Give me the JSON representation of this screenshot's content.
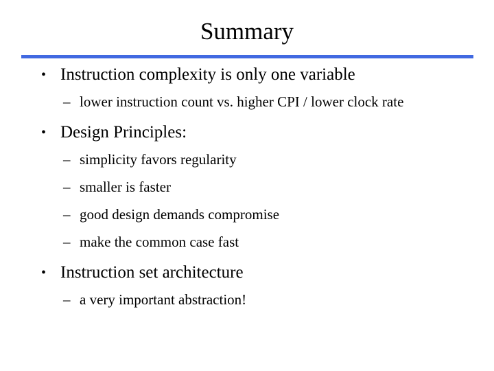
{
  "slide": {
    "title": "Summary",
    "accent_color": "#4169e1",
    "background_color": "#ffffff",
    "text_color": "#000000",
    "level1_marker": "•",
    "level2_marker": "–",
    "bullets": [
      {
        "text": "Instruction complexity is only one variable",
        "sub": [
          "lower instruction count vs. higher CPI / lower clock rate"
        ]
      },
      {
        "text": "Design Principles:",
        "sub": [
          "simplicity favors regularity",
          "smaller is faster",
          "good design demands compromise",
          "make the common case fast"
        ]
      },
      {
        "text": "Instruction set architecture",
        "sub": [
          "a very important abstraction!"
        ]
      }
    ]
  }
}
